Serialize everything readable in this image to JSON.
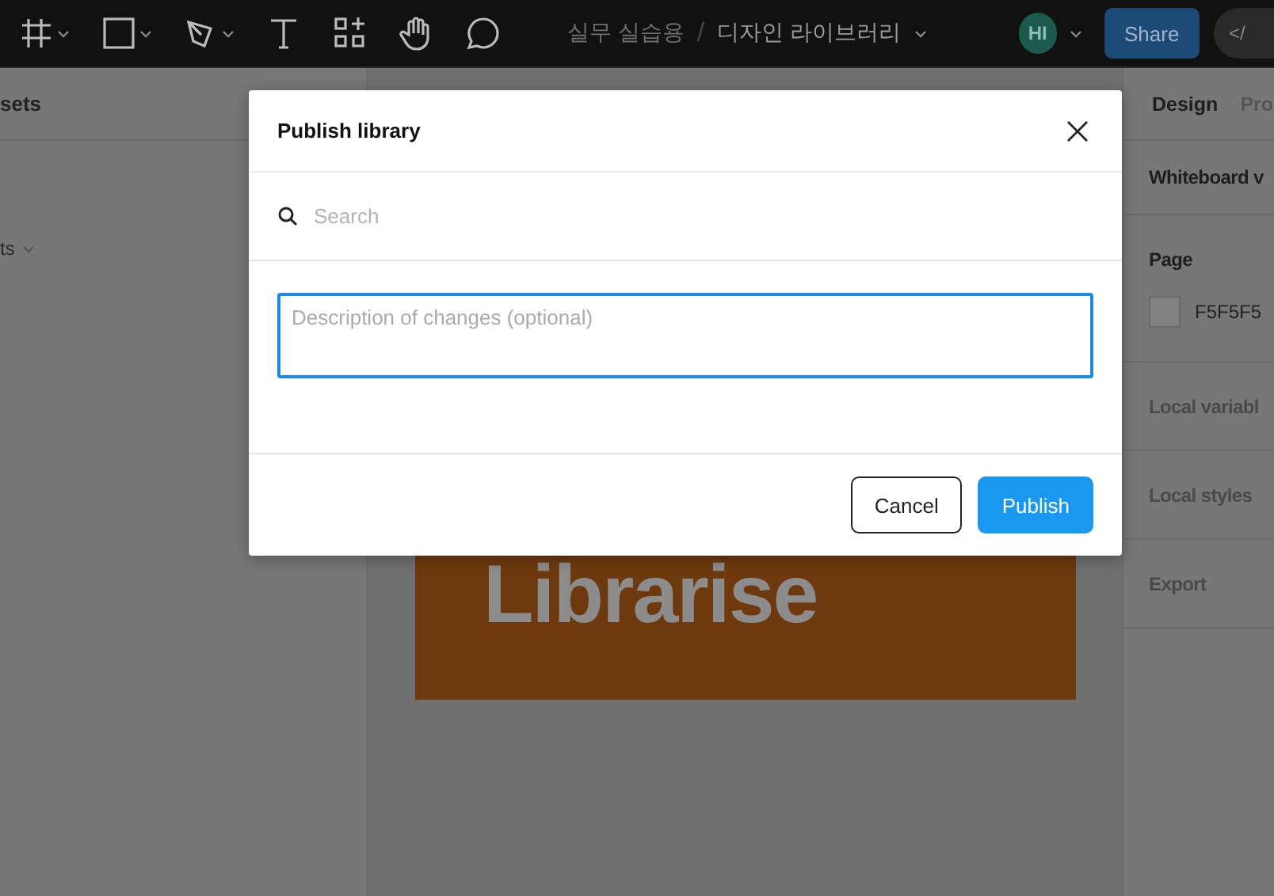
{
  "toolbar": {
    "project": {
      "folder": "실무 실습용",
      "separator": "/",
      "file": "디자인 라이브러리"
    },
    "user": {
      "initials": "HI"
    },
    "share": "Share",
    "dev_toggle": "</"
  },
  "left_panel": {
    "header": "sets",
    "item": "ts"
  },
  "canvas": {
    "card_text": "Librarise"
  },
  "right_panel": {
    "tabs": [
      {
        "label": "Design",
        "selected": true
      },
      {
        "label": "Pro",
        "selected": false
      }
    ],
    "sections": [
      {
        "kind": "title",
        "label": "Whiteboard v"
      },
      {
        "kind": "page",
        "label": "Page",
        "value": "F5F5F5"
      },
      {
        "kind": "muted",
        "label": "Local variabl"
      },
      {
        "kind": "muted",
        "label": "Local styles"
      },
      {
        "kind": "muted",
        "label": "Export"
      }
    ]
  },
  "dialog": {
    "title": "Publish library",
    "search": {
      "placeholder": "Search"
    },
    "description": {
      "placeholder": "Description of changes (optional)"
    },
    "buttons": [
      {
        "label": "Cancel",
        "kind": "secondary"
      },
      {
        "label": "Publish",
        "kind": "primary"
      }
    ]
  }
}
